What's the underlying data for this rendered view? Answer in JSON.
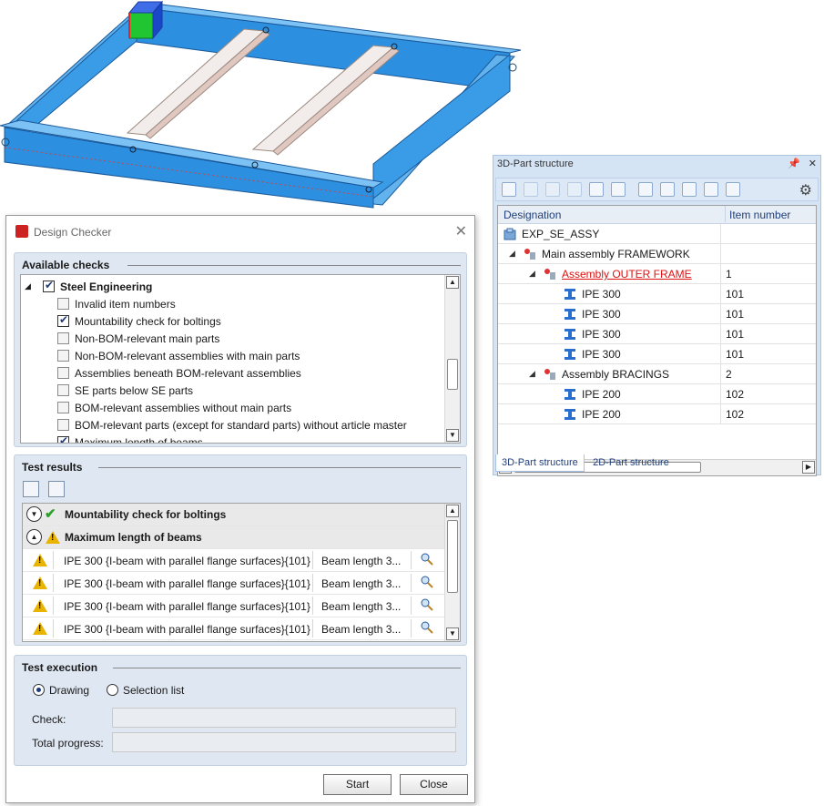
{
  "part_panel": {
    "title": "3D-Part structure",
    "pin_icon": "pin-icon",
    "close_icon": "close-icon",
    "columns": [
      "Designation",
      "Item number"
    ],
    "rows": [
      {
        "label": "EXP_SE_ASSY",
        "item": "",
        "indent": 0,
        "arrow": "",
        "icon": "assembly-icon",
        "highlight": false
      },
      {
        "label": "Main assembly FRAMEWORK",
        "item": "",
        "indent": 1,
        "arrow": "◢",
        "icon": "main-assembly-icon",
        "highlight": false
      },
      {
        "label": "Assembly OUTER FRAME",
        "item": "1",
        "indent": 2,
        "arrow": "◢",
        "icon": "sub-assembly-icon",
        "highlight": true
      },
      {
        "label": "IPE 300",
        "item": "101",
        "indent": 3,
        "arrow": "",
        "icon": "ibeam-icon",
        "highlight": false
      },
      {
        "label": "IPE 300",
        "item": "101",
        "indent": 3,
        "arrow": "",
        "icon": "ibeam-icon",
        "highlight": false
      },
      {
        "label": "IPE 300",
        "item": "101",
        "indent": 3,
        "arrow": "",
        "icon": "ibeam-icon",
        "highlight": false
      },
      {
        "label": "IPE 300",
        "item": "101",
        "indent": 3,
        "arrow": "",
        "icon": "ibeam-icon",
        "highlight": false
      },
      {
        "label": "Assembly BRACINGS",
        "item": "2",
        "indent": 2,
        "arrow": "◢",
        "icon": "sub-assembly-icon",
        "highlight": false
      },
      {
        "label": "IPE 200",
        "item": "102",
        "indent": 3,
        "arrow": "",
        "icon": "ibeam-icon",
        "highlight": false
      },
      {
        "label": "IPE 200",
        "item": "102",
        "indent": 3,
        "arrow": "",
        "icon": "ibeam-icon",
        "highlight": false
      }
    ],
    "tabs": [
      "3D-Part structure",
      "2D-Part structure"
    ]
  },
  "dialog": {
    "title": "Design Checker",
    "available_checks": {
      "title": "Available checks",
      "parent": "Steel Engineering",
      "items": [
        {
          "label": "Invalid item numbers",
          "checked": false
        },
        {
          "label": "Mountability check for boltings",
          "checked": true
        },
        {
          "label": "Non-BOM-relevant main parts",
          "checked": false
        },
        {
          "label": "Non-BOM-relevant assemblies with main parts",
          "checked": false
        },
        {
          "label": "Assemblies beneath BOM-relevant assemblies",
          "checked": false
        },
        {
          "label": "SE parts below SE parts",
          "checked": false
        },
        {
          "label": "BOM-relevant assemblies without main parts",
          "checked": false
        },
        {
          "label": "BOM-relevant parts (except for standard parts) without article master",
          "checked": false
        },
        {
          "label": "Maximum length of beams",
          "checked": true
        }
      ]
    },
    "test_results": {
      "title": "Test results",
      "groups": [
        {
          "label": "Mountability check for boltings",
          "status": "ok"
        },
        {
          "label": "Maximum length of beams",
          "status": "warning"
        }
      ],
      "rows": [
        {
          "part": "IPE 300 {I-beam with parallel flange surfaces}{101}",
          "message": "Beam length 3..."
        },
        {
          "part": "IPE 300 {I-beam with parallel flange surfaces}{101}",
          "message": "Beam length 3..."
        },
        {
          "part": "IPE 300 {I-beam with parallel flange surfaces}{101}",
          "message": "Beam length 3..."
        },
        {
          "part": "IPE 300 {I-beam with parallel flange surfaces}{101}",
          "message": "Beam length 3..."
        }
      ]
    },
    "test_execution": {
      "title": "Test execution",
      "mode_drawing": "Drawing",
      "mode_selection": "Selection list",
      "selected_mode": "Drawing",
      "check_label": "Check:",
      "check_value": "",
      "total_label": "Total progress:",
      "total_value": ""
    },
    "buttons": {
      "start": "Start",
      "close": "Close"
    }
  },
  "colors": {
    "beam": "#3a9be6",
    "web": "#e8d8cc",
    "highlight_link": "#dd1111",
    "panel_bg": "#d4e4f5",
    "group_bg": "#dfe7f2"
  }
}
